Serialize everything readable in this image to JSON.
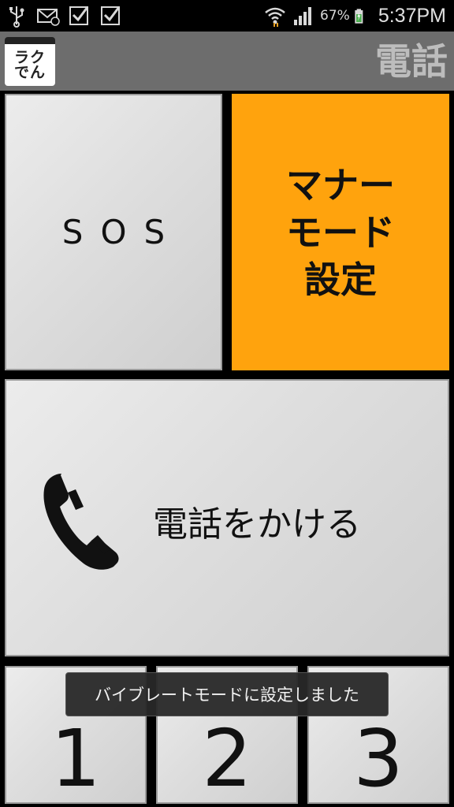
{
  "status_bar": {
    "battery_percent": "67%",
    "time": "5:37PM",
    "icons": [
      "usb-icon",
      "mail-icon",
      "check-icon",
      "check-icon",
      "wifi-icon",
      "signal-icon",
      "battery-charging-icon"
    ]
  },
  "title_bar": {
    "app_icon_line1": "ラク",
    "app_icon_line2": "でん",
    "title": "電話"
  },
  "tiles": {
    "sos_label": "SOS",
    "manner_line1": "マナー",
    "manner_line2": "モード",
    "manner_line3": "設定",
    "call_label": "電話をかける",
    "num1": "1",
    "num2": "2",
    "num3": "3"
  },
  "toast": {
    "message": "バイブレートモードに設定しました"
  },
  "colors": {
    "manner_tile": "#ffa30d",
    "title_bar": "#6d6d6d",
    "tile_gray": "#dedede"
  }
}
